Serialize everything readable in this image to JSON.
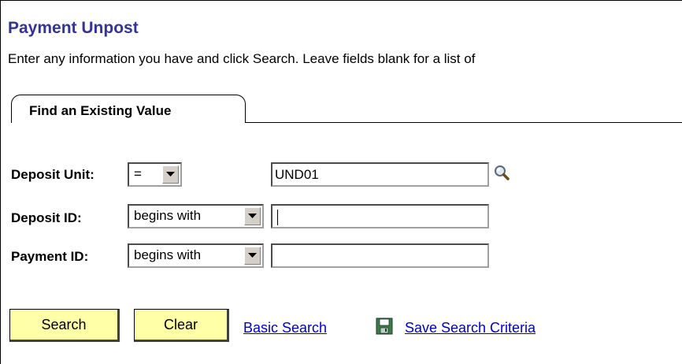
{
  "page": {
    "title": "Payment Unpost",
    "instructions": "Enter any information you have and click Search. Leave fields blank for a list of"
  },
  "tabs": [
    {
      "label": "Find an Existing Value",
      "selected": true
    }
  ],
  "fields": {
    "deposit_unit": {
      "label": "Deposit Unit:",
      "operator": "=",
      "value": "UND01",
      "lookup_icon": "magnifier-icon"
    },
    "deposit_id": {
      "label": "Deposit ID:",
      "operator": "begins with",
      "value": ""
    },
    "payment_id": {
      "label": "Payment ID:",
      "operator": "begins with",
      "value": ""
    }
  },
  "actions": {
    "search_label": "Search",
    "clear_label": "Clear",
    "basic_search_label": "Basic Search",
    "save_criteria_label": "Save Search Criteria",
    "save_icon": "floppy-disk-icon"
  },
  "colors": {
    "title": "#333399",
    "button_bg": "#ffffa8",
    "link": "#0000cc"
  }
}
